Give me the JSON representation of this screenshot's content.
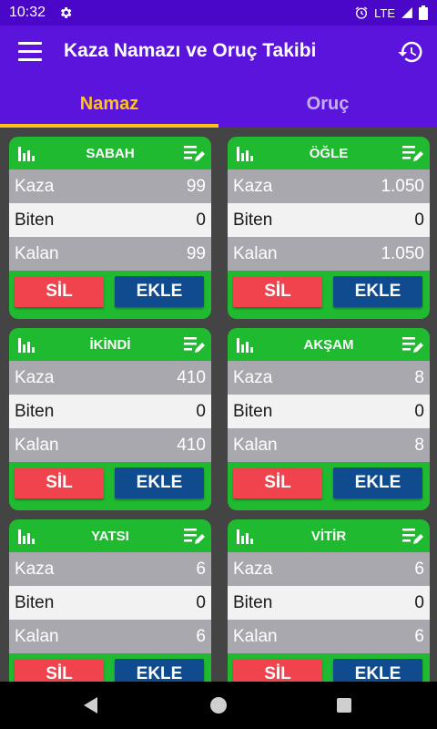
{
  "status": {
    "time": "10:32",
    "network": "LTE"
  },
  "app": {
    "title": "Kaza Namazı ve Oruç Takibi"
  },
  "tabs": [
    {
      "label": "Namaz",
      "active": true
    },
    {
      "label": "Oruç",
      "active": false
    }
  ],
  "labels": {
    "kaza": "Kaza",
    "biten": "Biten",
    "kalan": "Kalan",
    "sil": "SİL",
    "ekle": "EKLE"
  },
  "cards": [
    {
      "name": "SABAH",
      "kaza": "99",
      "biten": "0",
      "kalan": "99"
    },
    {
      "name": "ÖĞLE",
      "kaza": "1.050",
      "biten": "0",
      "kalan": "1.050"
    },
    {
      "name": "İKİNDİ",
      "kaza": "410",
      "biten": "0",
      "kalan": "410"
    },
    {
      "name": "AKŞAM",
      "kaza": "8",
      "biten": "0",
      "kalan": "8"
    },
    {
      "name": "YATSI",
      "kaza": "6",
      "biten": "0",
      "kalan": "6"
    },
    {
      "name": "VİTİR",
      "kaza": "6",
      "biten": "0",
      "kalan": "6"
    }
  ],
  "colors": {
    "app_bar": "#5a14dc",
    "status_bar": "#4a07c8",
    "tab_active": "#ffc21a",
    "card_green": "#1fba30",
    "sil_red": "#f0434e",
    "ekle_blue": "#0f4b8e"
  },
  "icons": {
    "status": [
      "gear-icon",
      "alarm-icon",
      "signal-icon",
      "battery-icon"
    ],
    "app_bar": [
      "hamburger-menu-icon",
      "history-icon"
    ],
    "card": [
      "bar-chart-icon",
      "edit-list-icon"
    ],
    "nav": [
      "back-icon",
      "home-icon",
      "recents-icon"
    ]
  }
}
